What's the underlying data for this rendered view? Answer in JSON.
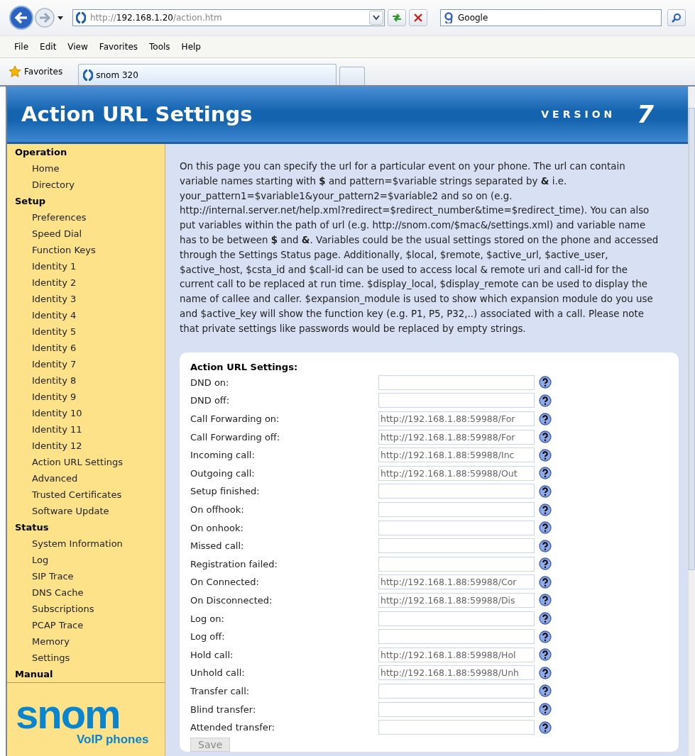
{
  "browser": {
    "address": {
      "scheme": "http://",
      "host": "192.168.1.20",
      "path": "/action.htm"
    },
    "search_box": {
      "value": "Google"
    },
    "menu": [
      "File",
      "Edit",
      "View",
      "Favorites",
      "Tools",
      "Help"
    ],
    "favorites_label": "Favorites",
    "tab_title": "snom 320"
  },
  "header": {
    "title": "Action URL Settings",
    "version_label": "VERSION",
    "version_number": "7"
  },
  "sidebar": {
    "sections": [
      {
        "title": "Operation",
        "items": [
          "Home",
          "Directory"
        ]
      },
      {
        "title": "Setup",
        "items": [
          "Preferences",
          "Speed Dial",
          "Function Keys",
          "Identity 1",
          "Identity 2",
          "Identity 3",
          "Identity 4",
          "Identity 5",
          "Identity 6",
          "Identity 7",
          "Identity 8",
          "Identity 9",
          "Identity 10",
          "Identity 11",
          "Identity 12",
          "Action URL Settings",
          "Advanced",
          "Trusted Certificates",
          "Software Update"
        ]
      },
      {
        "title": "Status",
        "items": [
          "System Information",
          "Log",
          "SIP Trace",
          "DNS Cache",
          "Subscriptions",
          "PCAP Trace",
          "Memory",
          "Settings"
        ]
      },
      {
        "title": "Manual"
      }
    ],
    "logo": {
      "wordmark": "snom",
      "tagline": "VoIP phones"
    }
  },
  "intro": "On this page you can specify the url for a particular event on your phone. The url can contain variable names starting with **$** and pattern=$variable strings separated by **&** i.e. your_pattern1=$variable1&your_pattern2=$variable2 and so on (e.g. http://internal.server.net/help.xml?redirect=$redirect_number&time=$redirect_time). You can also put variables within the path of url (e.g. http://snom.com/$mac&/settings.xml) and variable name has to be between **$** and **&**. Variables could be the usual settings stored on the phone and accessed through the Settings Status page. Additionally, $local, $remote, $active_url, $active_user, $active_host, $csta_id and $call-id can be used to access local & remote uri and call-id for the current call to be replaced at run time. $display_local, $display_remote can be used to display the name of callee and caller. $expansion_module is used to show which expansion module do you use and $active_key will show the function key (e.g. P1, P5, P32,..) associated with a call. Please note that private settings like passwords would be replaced by empty strings.",
  "form": {
    "title": "Action URL Settings:",
    "fields": [
      {
        "label": "DND on:"
      },
      {
        "label": "DND off:"
      },
      {
        "label": "Call Forwarding on:",
        "value": "http://192.168.1.88:59988/For"
      },
      {
        "label": "Call Forwarding off:",
        "value": "http://192.168.1.88:59988/For"
      },
      {
        "label": "Incoming call:",
        "value": "http://192.168.1.88:59988/Inc"
      },
      {
        "label": "Outgoing call:",
        "value": "http://192.168.1.88:59988/Out"
      },
      {
        "label": "Setup finished:"
      },
      {
        "label": "On offhook:"
      },
      {
        "label": "On onhook:"
      },
      {
        "label": "Missed call:"
      },
      {
        "label": "Registration failed:"
      },
      {
        "label": "On Connected:",
        "value": "http://192.168.1.88:59988/Cor"
      },
      {
        "label": "On Disconnected:",
        "value": "http://192.168.1.88:59988/Dis"
      },
      {
        "label": "Log on:"
      },
      {
        "label": "Log off:"
      },
      {
        "label": "Hold call:",
        "value": "http://192.168.1.88:59988/Hol"
      },
      {
        "label": "Unhold call:",
        "value": "http://192.168.1.88:59988/Unh"
      },
      {
        "label": "Transfer call:"
      },
      {
        "label": "Blind transfer:"
      },
      {
        "label": "Attended transfer:"
      }
    ],
    "save_button": "Save"
  }
}
